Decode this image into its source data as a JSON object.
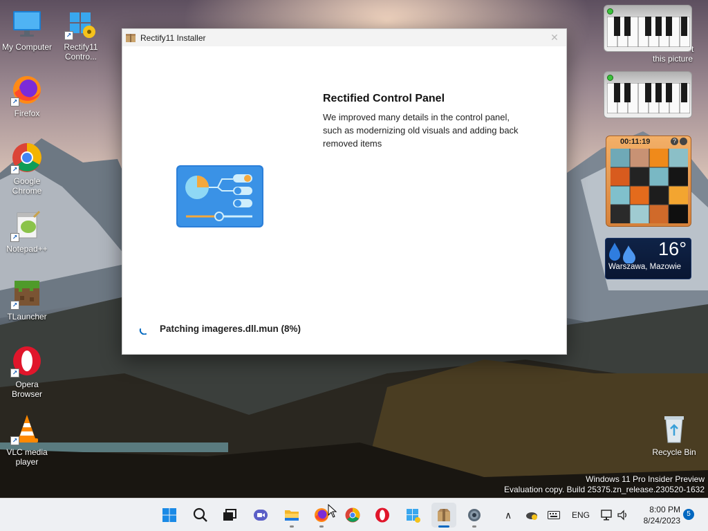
{
  "desktop": {
    "icons": [
      {
        "label": "My Computer"
      },
      {
        "label": "Rectify11 Contro..."
      },
      {
        "label": "Firefox"
      },
      {
        "label": "Google Chrome"
      },
      {
        "label": "Notepad++"
      },
      {
        "label": "TLauncher"
      },
      {
        "label": "Opera Browser"
      },
      {
        "label": "VLC media player"
      },
      {
        "label": "Recycle Bin"
      }
    ],
    "partial_text": [
      "t",
      "this picture"
    ],
    "watermark": {
      "line1": "Windows 11 Pro Insider Preview",
      "line2": "Evaluation copy. Build 25375.zn_release.230520-1632"
    }
  },
  "installer": {
    "title": "Rectify11 Installer",
    "close_glyph": "✕",
    "feature_title": "Rectified Control Panel",
    "feature_description": "We improved many details in the control panel, such as modernizing old visuals and adding back removed items",
    "status": "Patching imageres.dll.mun (8%)",
    "progress_percent": 8
  },
  "gadgets": {
    "puzzle_timer": "00:11:19",
    "puzzle_help": "?",
    "weather": {
      "temperature": "16°",
      "location": "Warszawa, Mazowie"
    }
  },
  "taskbar": {
    "language": "ENG",
    "time": "8:00 PM",
    "date": "8/24/2023",
    "notification_count": "5"
  },
  "colors": {
    "accent": "#0067c0",
    "control_panel_icon": "#2b7fd9",
    "opera_red": "#e0162b"
  }
}
